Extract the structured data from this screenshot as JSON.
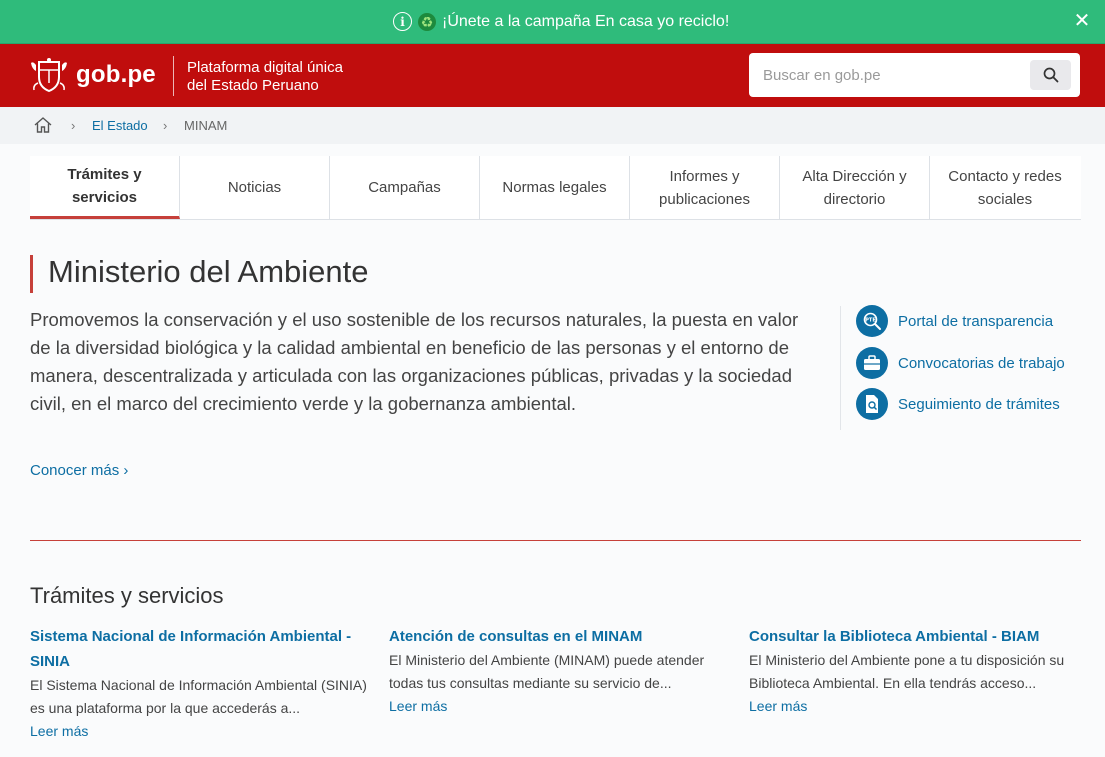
{
  "banner": {
    "text": "¡Únete a la campaña En casa yo reciclo!",
    "close": "✕"
  },
  "header": {
    "logo": "gob.pe",
    "subtitle_line1": "Plataforma digital única",
    "subtitle_line2": "del Estado Peruano",
    "search_placeholder": "Buscar en gob.pe"
  },
  "breadcrumb": {
    "sep": "›",
    "items": [
      "El Estado",
      "MINAM"
    ]
  },
  "tabs": [
    {
      "label": "Trámites y servicios",
      "active": true
    },
    {
      "label": "Noticias",
      "active": false
    },
    {
      "label": "Campañas",
      "active": false
    },
    {
      "label": "Normas legales",
      "active": false
    },
    {
      "label": "Informes y publicaciones",
      "active": false
    },
    {
      "label": "Alta Dirección y directorio",
      "active": false
    },
    {
      "label": "Contacto y redes sociales",
      "active": false
    }
  ],
  "main": {
    "title": "Ministerio del Ambiente",
    "description": "Promovemos la conservación y el uso sostenible de los recursos naturales, la puesta en valor de la diversidad biológica y la calidad ambiental en beneficio de las personas y el entorno de manera, descentralizada y articulada con las organizaciones públicas, privadas y la sociedad civil, en el marco del crecimiento verde y la gobernanza ambiental.",
    "more_link": "Conocer más ›"
  },
  "side_links": [
    {
      "label": "Portal de transparencia",
      "icon": "transparency-icon"
    },
    {
      "label": "Convocatorias de trabajo",
      "icon": "briefcase-icon"
    },
    {
      "label": "Seguimiento de trámites",
      "icon": "document-search-icon"
    }
  ],
  "services": {
    "title": "Trámites y servicios",
    "cards": [
      {
        "title": "Sistema Nacional de Información Ambiental - SINIA",
        "desc": "El Sistema Nacional de Información Ambiental (SINIA) es una plataforma por la que accederás a...",
        "more": "Leer más"
      },
      {
        "title": "Atención de consultas en el MINAM",
        "desc": "El Ministerio del Ambiente (MINAM) puede atender todas tus consultas mediante su servicio de...",
        "more": "Leer más"
      },
      {
        "title": "Consultar la Biblioteca Ambiental - BIAM",
        "desc": "El Ministerio del Ambiente pone a tu disposición su Biblioteca Ambiental. En ella tendrás acceso...",
        "more": "Leer más"
      }
    ]
  },
  "colors": {
    "banner": "#2fbb7b",
    "header": "#c00d0d",
    "link": "#0d6ea3",
    "accent": "#c6403a"
  }
}
